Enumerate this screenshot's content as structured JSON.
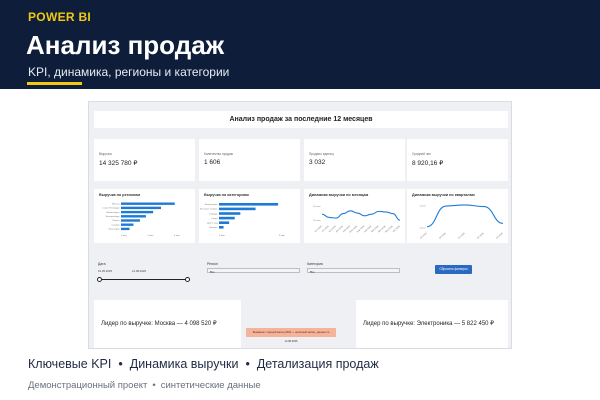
{
  "hero": {
    "brand": "POWER BI",
    "title": "Анализ продаж",
    "subtitle": "KPI, динамика, регионы и категории"
  },
  "report": {
    "title": "Анализ продаж за последние 12 месяцев",
    "kpis": [
      {
        "label": "Выручка",
        "value": "14 325 780 ₽"
      },
      {
        "label": "Количество продаж",
        "value": "1 606"
      },
      {
        "label": "Продано единиц",
        "value": "3 032"
      },
      {
        "label": "Средний чек",
        "value": "8 920,16 ₽"
      }
    ],
    "filters": {
      "date_label": "Дата",
      "date_from": "01.05.2025",
      "date_to": "14.08.2026",
      "region_label": "Регион",
      "region_value": "Все",
      "category_label": "Категория",
      "category_value": "Все",
      "reset_label": "Сбросить фильтры"
    },
    "leader_region": "Лидер по выручке: Москва — 4 098 520 ₽",
    "leader_category": "Лидер по выручке: Электроника — 5 822 450 ₽",
    "note": "Внимание: текущий месяц 2026 — неполный месяц, данные по 14.08.2026"
  },
  "chart_data": [
    {
      "type": "bar",
      "orientation": "horizontal",
      "title": "Выручка по регионам",
      "categories": [
        "Москва",
        "Санкт-Петербург",
        "Новосибирск",
        "Екатеринбург",
        "Казань",
        "Самара",
        "Краснодар"
      ],
      "values": [
        4.1,
        3.05,
        2.45,
        1.9,
        1.45,
        0.95,
        0.65
      ],
      "xticks": [
        "0 млн",
        "2 млн",
        "4 млн"
      ],
      "xlim": [
        0,
        4.5
      ]
    },
    {
      "type": "bar",
      "orientation": "horizontal",
      "title": "Выручка по категориям",
      "categories": [
        "Электроника",
        "Бытовая техника",
        "Одежда",
        "Спорт",
        "Дом и сад",
        "Красота"
      ],
      "values": [
        5.82,
        3.6,
        2.1,
        1.55,
        1.0,
        0.45
      ],
      "xticks": [
        "0 млн",
        "5 млн"
      ],
      "xlim": [
        0,
        6.5
      ]
    },
    {
      "type": "line",
      "title": "Динамика выручки по месяцам",
      "x": [
        "сен 2025",
        "окт 2025",
        "ноя 2025",
        "дек 2025",
        "янв 2026",
        "фев 2026",
        "мар 2026",
        "апр 2026",
        "май 2026",
        "июн 2026",
        "июл 2026",
        "авг 2026"
      ],
      "values": [
        1.22,
        1.1,
        1.08,
        1.24,
        1.34,
        1.26,
        1.16,
        1.22,
        1.32,
        1.3,
        1.24,
        1.0
      ],
      "yticks": [
        "1,0 млн",
        "1,5 млн"
      ],
      "ylim": [
        0.9,
        1.55
      ]
    },
    {
      "type": "line",
      "title": "Динамика выручки по кварталам",
      "x": [
        "Q3 2025",
        "Q4 2025",
        "Q1 2026",
        "Q2 2026",
        "Q3 2026"
      ],
      "values": [
        2.1,
        3.95,
        4.05,
        3.9,
        2.4
      ],
      "yticks": [
        "2 млн",
        "4 млн"
      ],
      "ylim": [
        1.8,
        4.4
      ]
    }
  ],
  "features": [
    "Ключевые KPI",
    "Динамика выручки",
    "Детализация продаж"
  ],
  "footer": [
    "Демонстрационный проект",
    "синтетические данные"
  ],
  "colors": {
    "navy": "#0e1e3a",
    "gold": "#f2c811",
    "bar": "#1f7ad6",
    "line": "#1f7ad6"
  }
}
